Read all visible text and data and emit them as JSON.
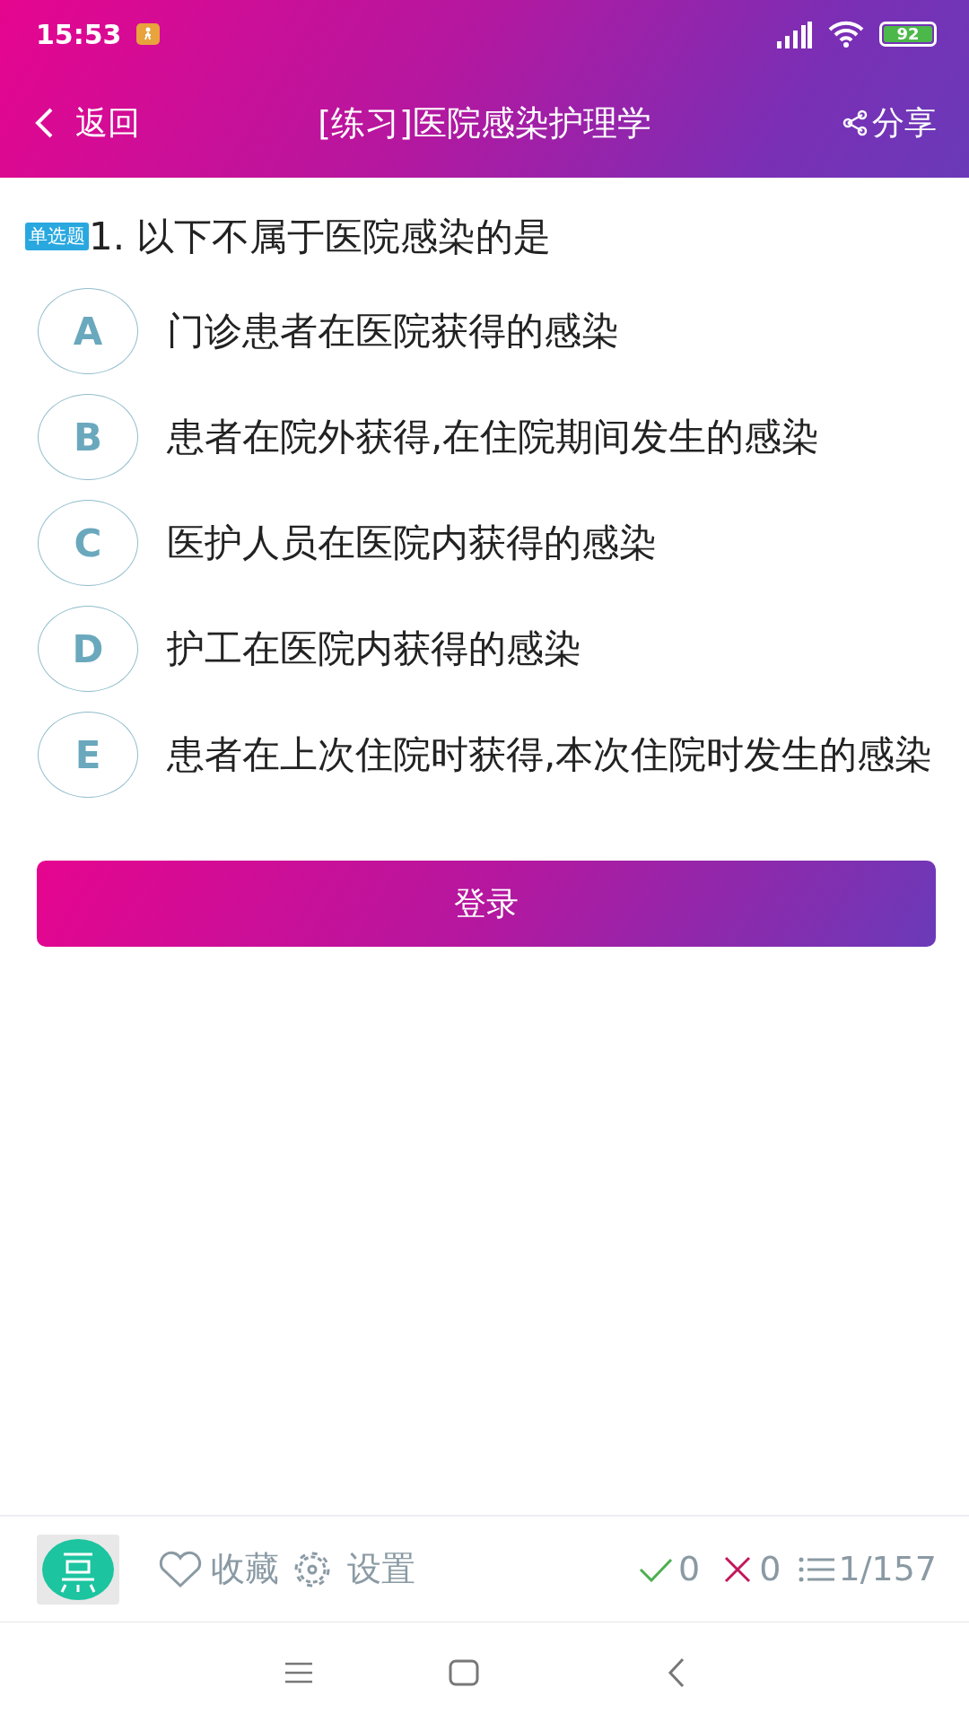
{
  "status_bar": {
    "time": "15:53",
    "battery": "92"
  },
  "header": {
    "back": "返回",
    "title": "[练习]医院感染护理学",
    "share": "分享"
  },
  "question": {
    "type_tag": "单选题",
    "text": "1. 以下不属于医院感染的是"
  },
  "options": [
    {
      "letter": "A",
      "text": "门诊患者在医院获得的感染"
    },
    {
      "letter": "B",
      "text": "患者在院外获得,在住院期间发生的感染"
    },
    {
      "letter": "C",
      "text": "医护人员在医院内获得的感染"
    },
    {
      "letter": "D",
      "text": "护工在医院内获得的感染"
    },
    {
      "letter": "E",
      "text": "患者在上次住院时获得,本次住院时发生的感染"
    }
  ],
  "action_button": "登录",
  "footer": {
    "favorite": "收藏",
    "settings": "设置",
    "correct_count": "0",
    "wrong_count": "0",
    "progress": "1/157"
  }
}
